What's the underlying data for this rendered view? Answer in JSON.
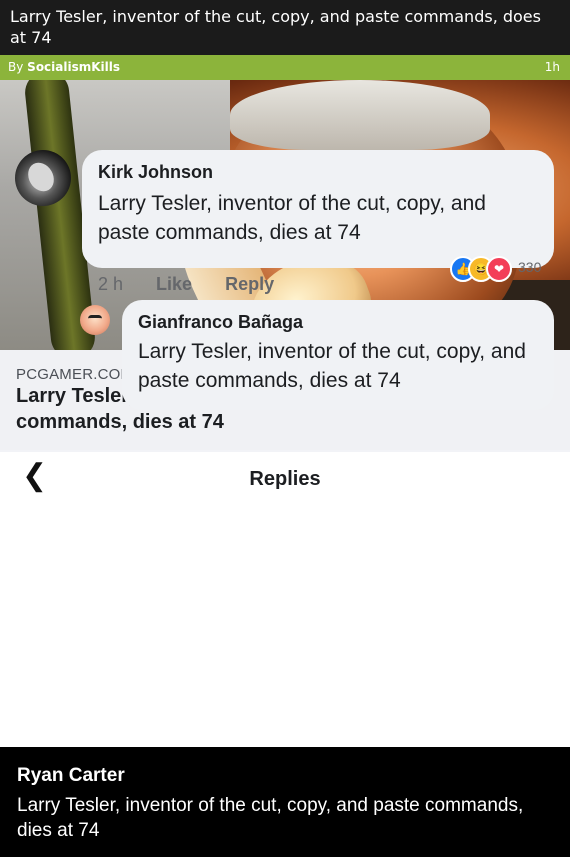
{
  "header": {
    "title": "Larry Tesler, inventor of the cut, copy, and paste commands, does at 74",
    "by_prefix": "By",
    "author": "SocialismKills",
    "age": "1h"
  },
  "post": {
    "link": {
      "source": "PCGAMER.COM",
      "headline": "Larry Tesler, inventor of the cut, copy, and paste commands, dies at 74"
    },
    "replies_panel": {
      "title": "Replies",
      "comments": [
        {
          "name": "Kirk Johnson",
          "text": "Larry Tesler, inventor of the cut, copy, and paste commands, dies at 74",
          "time": "2 h",
          "like_label": "Like",
          "reply_label": "Reply",
          "reaction_count": "330"
        },
        {
          "name": "Gianfranco Bañaga",
          "text": "Larry Tesler, inventor of the cut, copy, and paste commands, dies at 74"
        }
      ]
    }
  },
  "caption": {
    "name": "Ryan Carter",
    "text": "Larry Tesler, inventor of the cut, copy, and paste commands, dies at 74"
  },
  "icons": {
    "info": "info-icon",
    "back": "chevron-left-icon",
    "reactions": [
      "like-reaction-icon",
      "haha-reaction-icon",
      "love-reaction-icon"
    ]
  },
  "colors": {
    "author_bar": "#8cb43b",
    "title_bar": "#1b1b1b",
    "caption_bg": "#000000"
  }
}
